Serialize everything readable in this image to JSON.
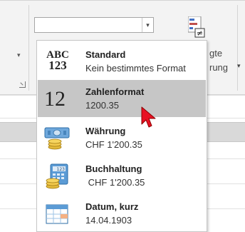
{
  "combo": {
    "value": "",
    "arrow": "▾"
  },
  "ribbon_right": {
    "line1": "gte",
    "line2": "rung",
    "arrow": "▾"
  },
  "left_arrow": "▾",
  "format_menu": {
    "items": [
      {
        "icon": "abc-123-icon",
        "title": "Standard",
        "sample": "Kein bestimmtes Format",
        "glyph_top": "ABC",
        "glyph_bottom": "123"
      },
      {
        "icon": "number-12-icon",
        "title": "Zahlenformat",
        "sample": "1200.35",
        "glyph": "12",
        "selected": true
      },
      {
        "icon": "currency-icon",
        "title": "Währung",
        "sample": "CHF 1'200.35"
      },
      {
        "icon": "accounting-icon",
        "title": "Buchhaltung",
        "sample": " CHF 1'200.35",
        "calc_text": "123"
      },
      {
        "icon": "calendar-icon",
        "title": "Datum, kurz",
        "sample": "14.04.1903"
      }
    ]
  },
  "colors": {
    "selected": "#c6c6c6",
    "cursor": "#e81123",
    "ribbon": "#f3f3f3"
  }
}
